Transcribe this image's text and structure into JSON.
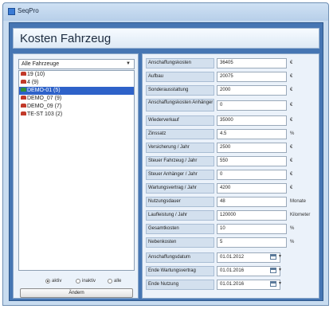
{
  "window": {
    "title": "SeqPro"
  },
  "header": {
    "title": "Kosten Fahrzeug"
  },
  "vehicle_filter": {
    "selected": "Alle Fahrzeuge"
  },
  "vehicles": [
    {
      "label": "19 (10)",
      "color": "red",
      "selected": false
    },
    {
      "label": "4 (9)",
      "color": "red",
      "selected": false
    },
    {
      "label": "DEMO-01 (5)",
      "color": "green",
      "selected": true
    },
    {
      "label": "DEMO_07 (9)",
      "color": "red",
      "selected": false
    },
    {
      "label": "DEMO_09 (7)",
      "color": "red",
      "selected": false
    },
    {
      "label": "TE-ST 103 (2)",
      "color": "red",
      "selected": false
    }
  ],
  "radio_options": [
    {
      "label": "aktiv",
      "checked": true
    },
    {
      "label": "inaktiv",
      "checked": false
    },
    {
      "label": "alle",
      "checked": false
    }
  ],
  "edit_button": {
    "label": "Ändern"
  },
  "form_fields": [
    {
      "label": "Anschaffungskosten",
      "value": "36405",
      "unit": "€"
    },
    {
      "label": "Aufbau",
      "value": "20075",
      "unit": "€"
    },
    {
      "label": "Sonderausstattung",
      "value": "2000",
      "unit": "€"
    },
    {
      "label": "Anschaffungskosten Anhänger",
      "value": "0",
      "unit": "€"
    },
    {
      "label": "Wiederverkauf",
      "value": "35000",
      "unit": "€"
    },
    {
      "label": "Zinssatz",
      "value": "4.5",
      "unit": "%"
    },
    {
      "label": "Versicherung / Jahr",
      "value": "2500",
      "unit": "€"
    },
    {
      "label": "Steuer Fahrzeug / Jahr",
      "value": "550",
      "unit": "€"
    },
    {
      "label": "Steuer Anhänger / Jahr",
      "value": "0",
      "unit": "€"
    },
    {
      "label": "Wartungsvertrag / Jahr",
      "value": "4200",
      "unit": "€"
    },
    {
      "label": "Nutzungsdauer",
      "value": "48",
      "unit": "Monate"
    },
    {
      "label": "Laufleistung / Jahr",
      "value": "120000",
      "unit": "Kilometer"
    },
    {
      "label": "Gesamtkosten",
      "value": "10",
      "unit": "%"
    },
    {
      "label": "Nebenkosten",
      "value": "5",
      "unit": "%"
    }
  ],
  "date_fields": [
    {
      "label": "Anschaffungsdatum",
      "value": "01.01.2012"
    },
    {
      "label": "Ende Wartungsvertrag",
      "value": "01.01.2016"
    },
    {
      "label": "Ende Nutzung",
      "value": "01.01.2016"
    }
  ]
}
